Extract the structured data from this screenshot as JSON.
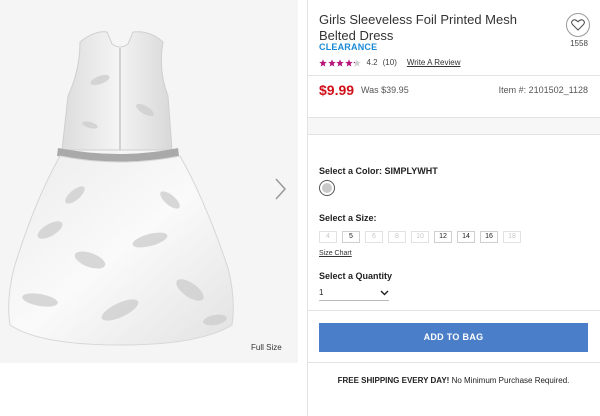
{
  "product": {
    "title": "Girls Sleeveless Foil Printed Mesh Belted Dress",
    "badge": "CLEARANCE",
    "favorites_count": "1558",
    "rating_value": "4.2",
    "rating_count": "(10)",
    "rating_stars": 4.2,
    "write_review": "Write A Review",
    "price": "$9.99",
    "was_price": "Was $39.95",
    "item_number": "Item #: 2101502_1128",
    "image_alt": "dress-image",
    "full_size_label": "Full Size"
  },
  "color": {
    "label": "Select a Color: SIMPLYWHT",
    "swatch_color": "#c9c9c9"
  },
  "size": {
    "label": "Select a Size:",
    "options": [
      {
        "value": "4",
        "available": false
      },
      {
        "value": "5",
        "available": true
      },
      {
        "value": "6",
        "available": false
      },
      {
        "value": "8",
        "available": false
      },
      {
        "value": "10",
        "available": false
      },
      {
        "value": "12",
        "available": true
      },
      {
        "value": "14",
        "available": true
      },
      {
        "value": "16",
        "available": true
      },
      {
        "value": "18",
        "available": false
      }
    ],
    "chart_link": "Size Chart"
  },
  "quantity": {
    "label": "Select a Quantity",
    "value": "1"
  },
  "cart": {
    "add_label": "ADD TO BAG"
  },
  "shipping": {
    "bold": "FREE SHIPPING EVERY DAY!",
    "rest": " No Minimum Purchase Required."
  },
  "colors": {
    "accent_blue": "#4a7ec8",
    "price_red": "#d10f19",
    "clearance_blue": "#1b8ad6",
    "star_magenta": "#b5167a"
  }
}
